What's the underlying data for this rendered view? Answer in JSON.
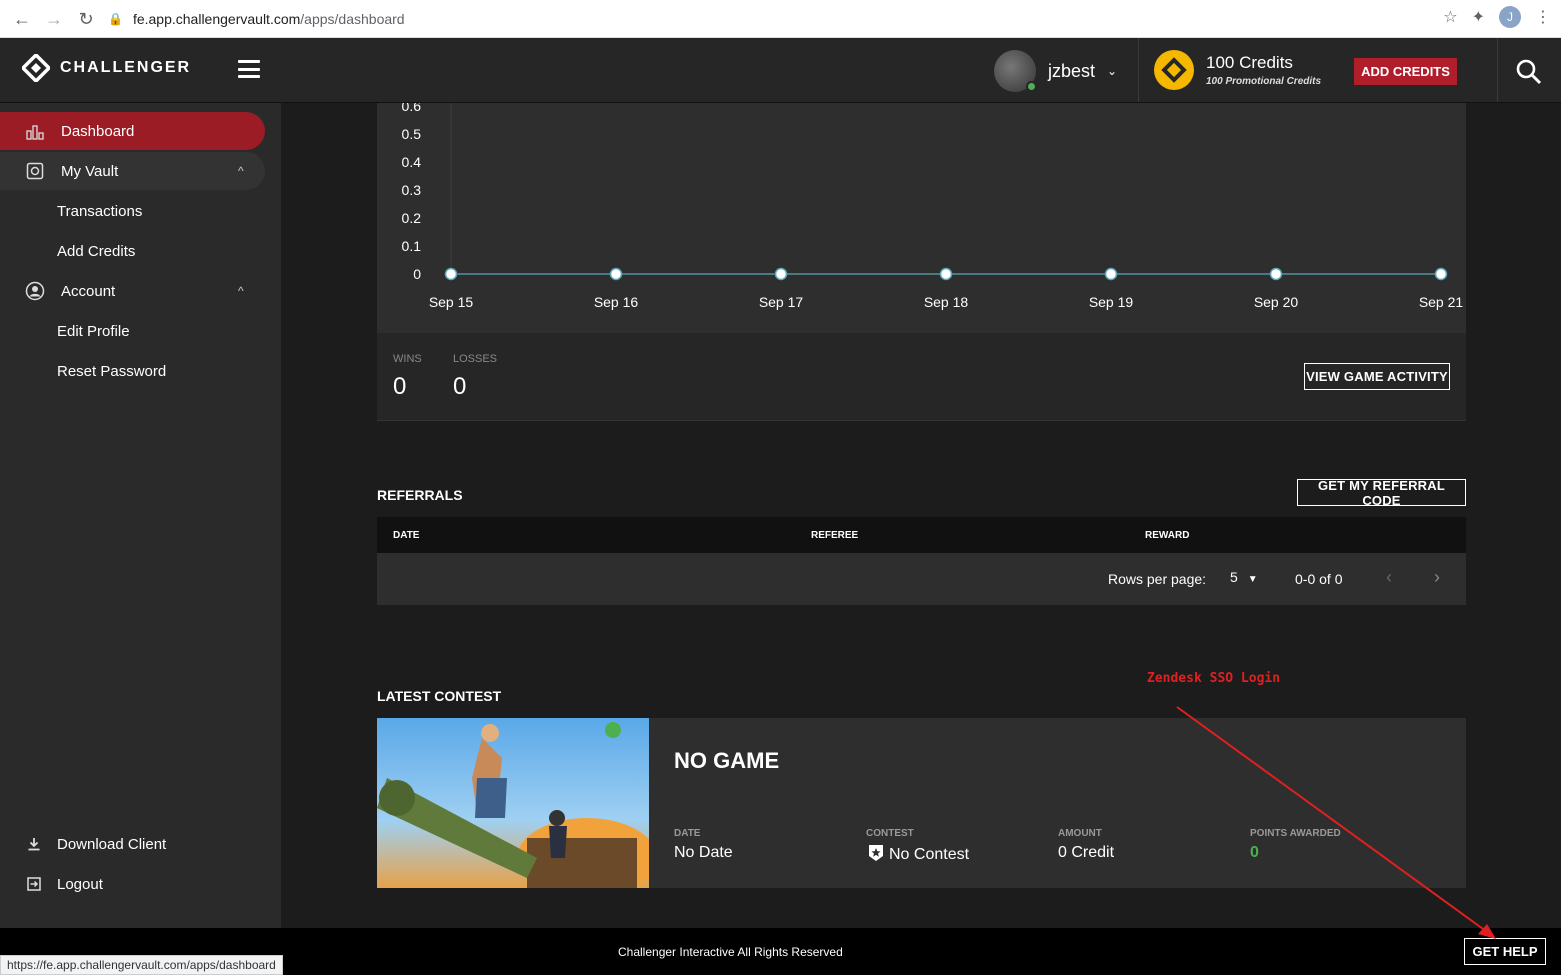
{
  "browser": {
    "url_host": "fe.app.challengervault.com",
    "url_path": "/apps/dashboard",
    "profile_initial": "J",
    "status_url": "https://fe.app.challengervault.com/apps/dashboard"
  },
  "header": {
    "logo_text": "CHALLENGER",
    "username": "jzbest",
    "credits": "100 Credits",
    "promo_credits": "100 Promotional Credits",
    "add_credits_label": "ADD CREDITS"
  },
  "sidebar": {
    "items": [
      {
        "label": "Dashboard",
        "icon": "dashboard-icon"
      },
      {
        "label": "My Vault",
        "icon": "vault-icon"
      },
      {
        "label": "Transactions"
      },
      {
        "label": "Add Credits"
      },
      {
        "label": "Account",
        "icon": "account-icon"
      },
      {
        "label": "Edit Profile"
      },
      {
        "label": "Reset Password"
      }
    ],
    "bottom": [
      {
        "label": "Download Client",
        "icon": "download-icon"
      },
      {
        "label": "Logout",
        "icon": "logout-icon"
      }
    ]
  },
  "chart_data": {
    "type": "line",
    "x": [
      "Sep 15",
      "Sep 16",
      "Sep 17",
      "Sep 18",
      "Sep 19",
      "Sep 20",
      "Sep 21"
    ],
    "series": [
      {
        "values": [
          0,
          0,
          0,
          0,
          0,
          0,
          0
        ]
      }
    ],
    "y_ticks": [
      "0",
      "0.1",
      "0.2",
      "0.3",
      "0.4",
      "0.5",
      "0.6"
    ],
    "ylim": [
      0,
      0.6
    ],
    "colors": {
      "line": "#5aa7b8",
      "point": "#ffffff"
    }
  },
  "stats": {
    "wins_label": "WINS",
    "wins": "0",
    "losses_label": "LOSSES",
    "losses": "0",
    "view_activity_label": "VIEW GAME ACTIVITY"
  },
  "referrals": {
    "title": "REFERRALS",
    "button_label": "GET MY REFERRAL CODE",
    "columns": [
      "DATE",
      "REFEREE",
      "REWARD"
    ],
    "rows_per_page_label": "Rows per page:",
    "rows_per_page": "5",
    "range": "0-0 of 0"
  },
  "latest_contest": {
    "title": "LATEST CONTEST",
    "game": "NO GAME",
    "date_label": "DATE",
    "date": "No Date",
    "contest_label": "CONTEST",
    "contest": "No Contest",
    "amount_label": "AMOUNT",
    "amount": "0 Credit",
    "points_label": "POINTS AWARDED",
    "points": "0"
  },
  "annotation": {
    "text": "Zendesk SSO Login",
    "color": "#e02020"
  },
  "footer": {
    "text": "Challenger Interactive All Rights Reserved",
    "help_label": "GET HELP"
  }
}
